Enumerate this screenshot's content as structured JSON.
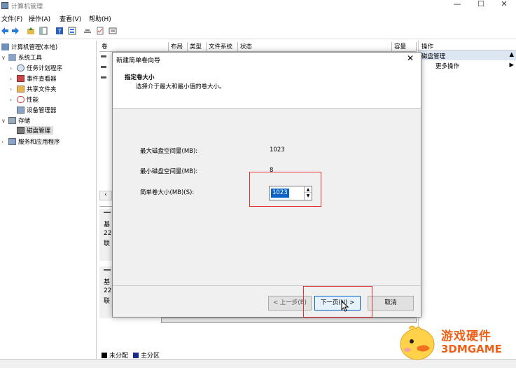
{
  "window": {
    "title": "计算机管理"
  },
  "menu": [
    "文件(F)",
    "操作(A)",
    "查看(V)",
    "帮助(H)"
  ],
  "tree": {
    "root": "计算机管理(本地)",
    "system_tools": "系统工具",
    "task_scheduler": "任务计划程序",
    "event_viewer": "事件查看器",
    "shared_folders": "共享文件夹",
    "performance": "性能",
    "device_manager": "设备管理器",
    "storage": "存储",
    "disk_management": "磁盘管理",
    "services": "服务和应用程序"
  },
  "columns": [
    "卷",
    "布局",
    "类型",
    "文件系统",
    "状态",
    "容量"
  ],
  "disk_labels": {
    "d1": [
      "基",
      "22",
      "联"
    ],
    "d2": [
      "基",
      "22",
      "联"
    ]
  },
  "legend": {
    "unallocated": "未分配",
    "primary": "主分区"
  },
  "actions": {
    "header": "操作",
    "section": "磁盘管理",
    "more": "更多操作"
  },
  "dialog": {
    "title": "新建简单卷向导",
    "heading": "指定卷大小",
    "subheading": "选择介于最大和最小值的卷大小。",
    "max_label": "最大磁盘空间量(MB):",
    "max_value": "1023",
    "min_label": "最小磁盘空间量(MB):",
    "min_value": "8",
    "size_label": "简单卷大小(MB)(S):",
    "size_value": "1023",
    "back": "< 上一步(B)",
    "next": "下一页(N) >",
    "cancel": "取消"
  },
  "watermark": {
    "cn": "游戏硬件",
    "en": "3DMGAME"
  }
}
